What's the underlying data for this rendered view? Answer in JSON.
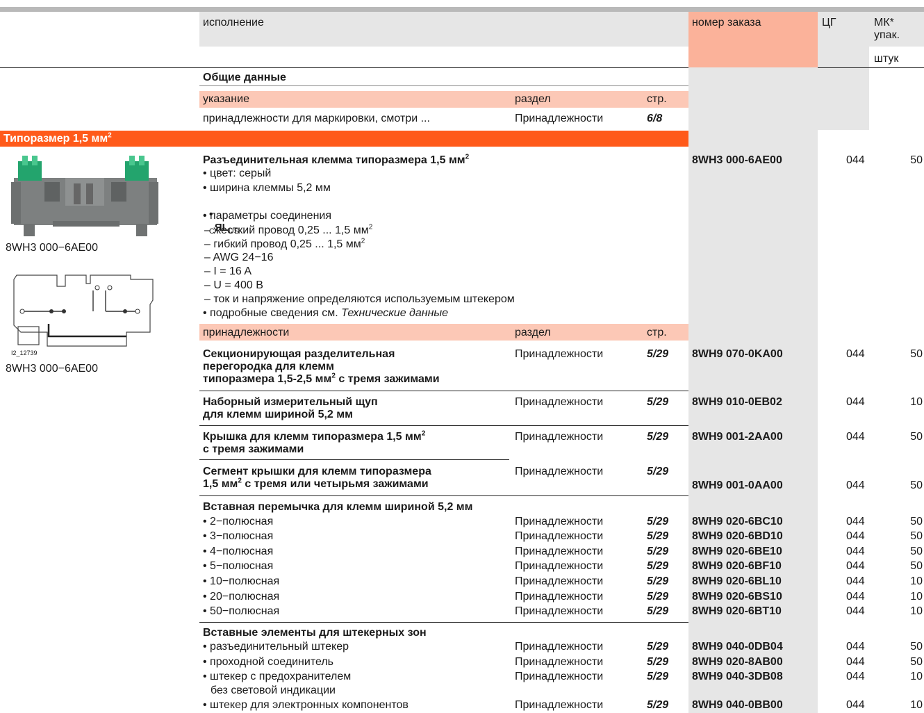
{
  "header": {
    "col_execution": "исполнение",
    "col_order": "номер заказа",
    "col_pg": "ЦГ",
    "col_mk_line1": "МК*",
    "col_mk_line2": "упак.",
    "col_mk_unit": "штук"
  },
  "general": {
    "title": "Общие данные",
    "hdr_note": "указание",
    "hdr_section": "раздел",
    "hdr_page": "стр.",
    "row_text": "принадлежности для маркировки, смотри ...",
    "row_section": "Принадлежности",
    "row_page": "6/8"
  },
  "band": {
    "label": "Типоразмер 1,5 мм",
    "sup": "2"
  },
  "left": {
    "photo_caption": "8WH3 000−6AE00",
    "diagram_id": "I2_12739",
    "diagram_caption": "8WH3 000−6AE00"
  },
  "product": {
    "title": "Разъединительная клемма типоразмера 1,5 мм",
    "title_sup": "2",
    "order": "8WH3 000-6AE00",
    "pg": "044",
    "mk": "50",
    "color": "• цвет: серый",
    "width": "• ширина клеммы 5,2 мм",
    "cert_bullet": "•",
    "cert_c": "C",
    "cert_mark": "ЯL",
    "cert_us": "US",
    "params": "• параметры соединения",
    "rigid": "– жесткий провод 0,25 ... 1,5 мм",
    "flex": "– гибкий провод 0,25 ... 1,5 мм",
    "awg": "– AWG 24−16",
    "current": "– I = 16 A",
    "voltage": "– U = 400 B",
    "note": "– ток и напряжение определяются используемым штекером",
    "details_prefix": "• подробные сведения см. ",
    "details_link": "Технические данные"
  },
  "acc_header": {
    "col1": "принадлежности",
    "col2": "раздел",
    "col3": "стр."
  },
  "accessories": [
    {
      "l1": "Секционирующая разделительная",
      "l2": "перегородка для клемм",
      "l3": "типоразмера 1,5-2,5 мм",
      "l3sup": "2",
      "l3end": " с тремя зажимами",
      "section": "Принадлежности",
      "page": "5/29",
      "order": "8WH9 070-0KA00",
      "pg": "044",
      "mk": "50"
    },
    {
      "l1": "Наборный измерительный щуп",
      "l2": "для клемм шириной 5,2 мм",
      "section": "Принадлежности",
      "page": "5/29",
      "order": "8WH9 010-0EB02",
      "pg": "044",
      "mk": "10"
    },
    {
      "l1": "Крышка для клемм типоразмера 1,5 мм",
      "l1sup": "2",
      "l2": "с тремя зажимами",
      "section": "Принадлежности",
      "page": "5/29",
      "order": "8WH9 001-2AA00",
      "pg": "044",
      "mk": "50"
    },
    {
      "l1": "Сегмент крышки для клемм типоразмера",
      "l2": "1,5 мм",
      "l2sup": "2",
      "l2end": " с тремя или четырьмя зажимами",
      "section": "Принадлежности",
      "page": "5/29",
      "order": "8WH9 001-0AA00",
      "pg": "044",
      "mk": "50"
    }
  ],
  "jumpers": {
    "title": "Вставная перемычка для клемм шириной 5,2 мм",
    "rows": [
      {
        "label": "• 2−полюсная",
        "section": "Принадлежности",
        "page": "5/29",
        "order": "8WH9 020-6BC10",
        "pg": "044",
        "mk": "50"
      },
      {
        "label": "• 3−полюсная",
        "section": "Принадлежности",
        "page": "5/29",
        "order": "8WH9 020-6BD10",
        "pg": "044",
        "mk": "50"
      },
      {
        "label": "• 4−полюсная",
        "section": "Принадлежности",
        "page": "5/29",
        "order": "8WH9 020-6BE10",
        "pg": "044",
        "mk": "50"
      },
      {
        "label": "• 5−полюсная",
        "section": "Принадлежности",
        "page": "5/29",
        "order": "8WH9 020-6BF10",
        "pg": "044",
        "mk": "50"
      },
      {
        "label": "• 10−полюсная",
        "section": "Принадлежности",
        "page": "5/29",
        "order": "8WH9 020-6BL10",
        "pg": "044",
        "mk": "10"
      },
      {
        "label": "• 20−полюсная",
        "section": "Принадлежности",
        "page": "5/29",
        "order": "8WH9 020-6BS10",
        "pg": "044",
        "mk": "10"
      },
      {
        "label": "• 50−полюсная",
        "section": "Принадлежности",
        "page": "5/29",
        "order": "8WH9 020-6BT10",
        "pg": "044",
        "mk": "10"
      }
    ]
  },
  "plugs": {
    "title": "Вставные элементы для штекерных зон",
    "rows": [
      {
        "label": "• разъединительный штекер",
        "section": "Принадлежности",
        "page": "5/29",
        "order": "8WH9 040-0DB04",
        "pg": "044",
        "mk": "50"
      },
      {
        "label": "• проходной соединитель",
        "section": "Принадлежности",
        "page": "5/29",
        "order": "8WH9 020-8AB00",
        "pg": "044",
        "mk": "50"
      },
      {
        "label": "• штекер с предохранителем",
        "label2": "без световой индикации",
        "section": "Принадлежности",
        "page": "5/29",
        "order": "8WH9 040-3DB08",
        "pg": "044",
        "mk": "10"
      },
      {
        "label": "• штекер для электронных компонентов",
        "section": "Принадлежности",
        "page": "5/29",
        "order": "8WH9 040-0BB00",
        "pg": "044",
        "mk": "10"
      }
    ]
  }
}
